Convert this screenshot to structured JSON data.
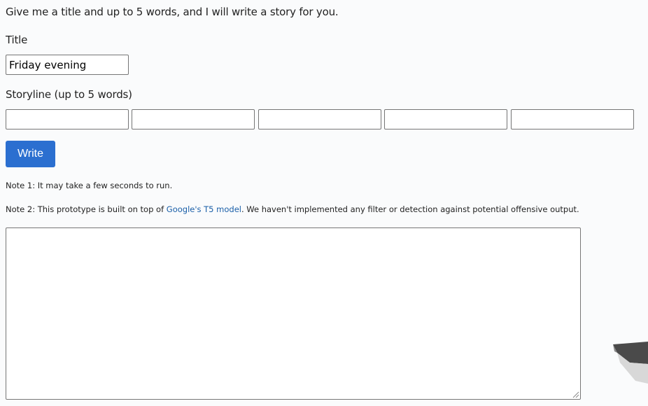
{
  "intro_text": "Give me a title and up to 5 words, and I will write a story for you.",
  "title_section": {
    "label": "Title",
    "value": "Friday evening"
  },
  "storyline_section": {
    "label": "Storyline (up to 5 words)",
    "words": [
      "",
      "",
      "",
      "",
      ""
    ]
  },
  "write_button": {
    "label": "Write"
  },
  "notes": {
    "note1": "Note 1: It may take a few seconds to run.",
    "note2_prefix": "Note 2: This prototype is built on top of ",
    "note2_link": "Google's T5 model",
    "note2_suffix": ". We haven't implemented any filter or detection against potential offensive output."
  },
  "output": {
    "value": ""
  },
  "colors": {
    "accent": "#2b6fd0",
    "link": "#1a5fa8"
  }
}
